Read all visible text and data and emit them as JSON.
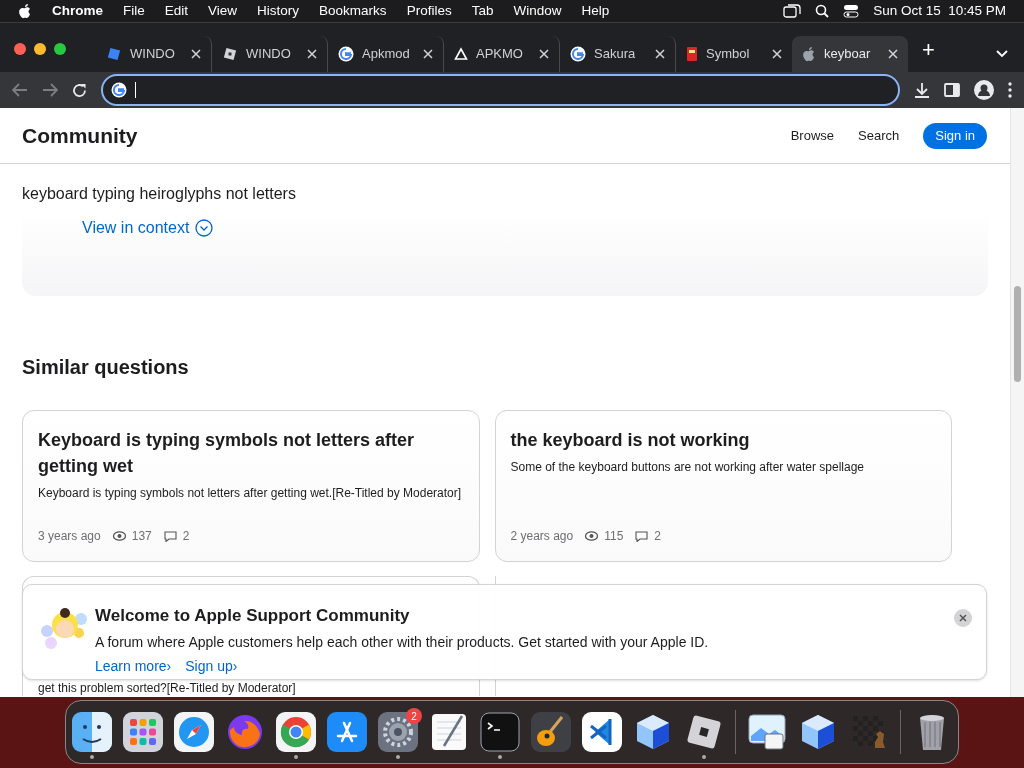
{
  "menu_bar": {
    "app": "Chrome",
    "items": [
      "File",
      "Edit",
      "View",
      "History",
      "Bookmarks",
      "Profiles",
      "Tab",
      "Window",
      "Help"
    ],
    "clock": "Sun Oct 15  10:45 PM"
  },
  "tabs": [
    {
      "title": "WINDO",
      "kind": "roblox-blue",
      "selected": false
    },
    {
      "title": "WINDO",
      "kind": "roblox",
      "selected": false
    },
    {
      "title": "Apkmod",
      "kind": "google",
      "selected": false
    },
    {
      "title": "APKMO",
      "kind": "triangle",
      "selected": false
    },
    {
      "title": "Sakura",
      "kind": "google",
      "selected": false
    },
    {
      "title": "Symbol",
      "kind": "book",
      "selected": false
    },
    {
      "title": "keyboar",
      "kind": "apple",
      "selected": true
    }
  ],
  "new_tab": "+",
  "header": {
    "title": "Community",
    "links": [
      "Browse",
      "Search"
    ],
    "sign_in": "Sign in"
  },
  "question_title": "keyboard typing heiroglyphs not letters",
  "view_in_context": "View in context",
  "similar_heading": "Similar questions",
  "cards": [
    {
      "title": "Keyboard is typing symbols not letters after getting wet",
      "body": "Keyboard is typing symbols not letters after getting wet.[Re-Titled by Moderator]",
      "age": "3 years ago",
      "views": "137",
      "replies": "2"
    },
    {
      "title": "the keyboard is not working",
      "body": "Some of the keyboard buttons are not working after water spellage",
      "age": "2 years ago",
      "views": "115",
      "replies": "2"
    }
  ],
  "partial_card_text": "get this problem sorted?[Re-Titled by Moderator]",
  "banner": {
    "title": "Welcome to Apple Support Community",
    "text": "A forum where Apple customers help each other with their products. Get started with your Apple ID.",
    "links": [
      "Learn more",
      "Sign up"
    ],
    "chevron": "›"
  },
  "dock": [
    {
      "kind": "finder",
      "running": true
    },
    {
      "kind": "launchpad",
      "running": false
    },
    {
      "kind": "safari",
      "running": false
    },
    {
      "kind": "firefox",
      "running": false
    },
    {
      "kind": "chrome",
      "running": true
    },
    {
      "kind": "appstore",
      "running": false
    },
    {
      "kind": "settings",
      "running": true,
      "badge": "2"
    },
    {
      "kind": "textedit",
      "running": false
    },
    {
      "kind": "terminal",
      "running": true
    },
    {
      "kind": "guitar",
      "running": false
    },
    {
      "kind": "vscode",
      "running": false
    },
    {
      "kind": "cube",
      "running": false
    },
    {
      "kind": "roblox",
      "running": true
    },
    {
      "kind": "separator"
    },
    {
      "kind": "preview",
      "running": false
    },
    {
      "kind": "cube",
      "running": false
    },
    {
      "kind": "chess",
      "running": false
    },
    {
      "kind": "separator"
    },
    {
      "kind": "trash",
      "running": false
    }
  ]
}
